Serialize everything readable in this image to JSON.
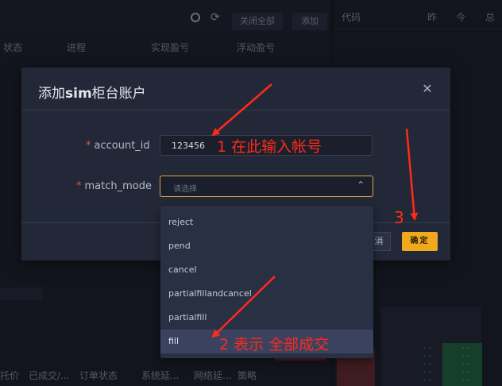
{
  "toolbar": {
    "close_all": "关闭全部",
    "add": "添加"
  },
  "positions_header": {
    "status": "状态",
    "progress": "进程",
    "realized_pnl": "实现盈亏",
    "floating_pnl": "浮动盈亏"
  },
  "right_header": {
    "code": "代码",
    "yesterday": "昨",
    "today": "今",
    "total": "总"
  },
  "orders_header": {
    "commission": "托价",
    "filled": "已成交/...",
    "order_status": "订单状态",
    "system_delay": "系统延...",
    "network_delay": "网络延...",
    "strategy": "策略"
  },
  "modal": {
    "title_prefix": "添加",
    "title_bold": "sim",
    "title_suffix": "柜台账户",
    "fields": {
      "account_id": {
        "label": "account_id",
        "value": "123456"
      },
      "match_mode": {
        "label": "match_mode",
        "placeholder": "请选择"
      }
    },
    "cancel_label": "消",
    "ok_label": "确定"
  },
  "dropdown": {
    "options": [
      "reject",
      "pend",
      "cancel",
      "partialfillandcancel",
      "partialfill",
      "fill"
    ],
    "highlighted": "fill"
  },
  "annotations": {
    "a1": "1 在此输入帐号",
    "a2": "2 表示 全部成交",
    "a3": "3"
  },
  "colors": {
    "accent": "#f0a81d",
    "annotation": "#ff2a1a",
    "required": "#e0524f"
  }
}
